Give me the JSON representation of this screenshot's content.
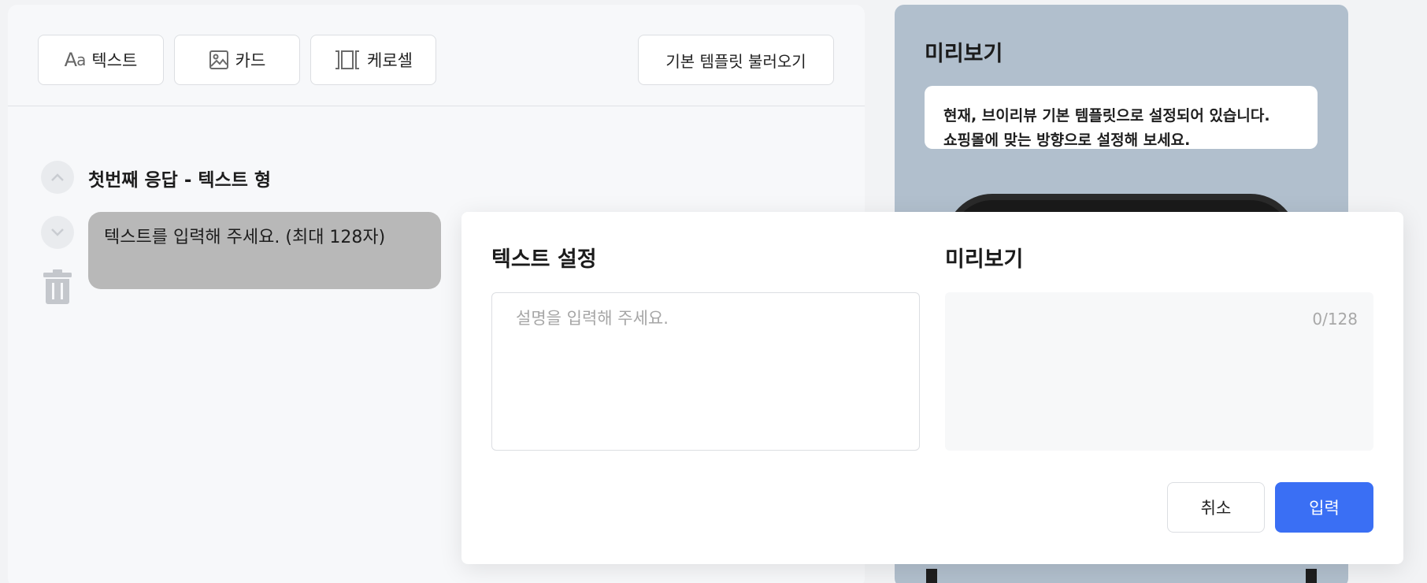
{
  "toolbar": {
    "text_label": "텍스트",
    "text_icon_big": "A",
    "text_icon_small": "a",
    "card_label": "카드",
    "carousel_label": "케로셀",
    "template_label": "기본 템플릿 불러오기"
  },
  "editor": {
    "response_title": "첫번째 응답 - 텍스트 형",
    "bubble_text": "텍스트를 입력해 주세요. (최대 128자)"
  },
  "preview_panel": {
    "title": "미리보기",
    "note_line1": "현재, 브이리뷰 기본 템플릿으로 설정되어 있습니다.",
    "note_line2": "쇼핑몰에 맞는 방향으로 설정해 보세요."
  },
  "modal": {
    "left_title": "텍스트 설정",
    "right_title": "미리보기",
    "textarea_placeholder": "설명을 입력해 주세요.",
    "textarea_value": "",
    "counter": "0/128",
    "cancel_label": "취소",
    "submit_label": "입력"
  },
  "colors": {
    "accent": "#3a6ff4",
    "preview_bg": "#b1bfcd",
    "bubble_bg": "#b8b8b8"
  },
  "icons": [
    "text-format-icon",
    "image-icon",
    "carousel-icon",
    "chevron-up-icon",
    "chevron-down-icon",
    "trash-icon"
  ]
}
